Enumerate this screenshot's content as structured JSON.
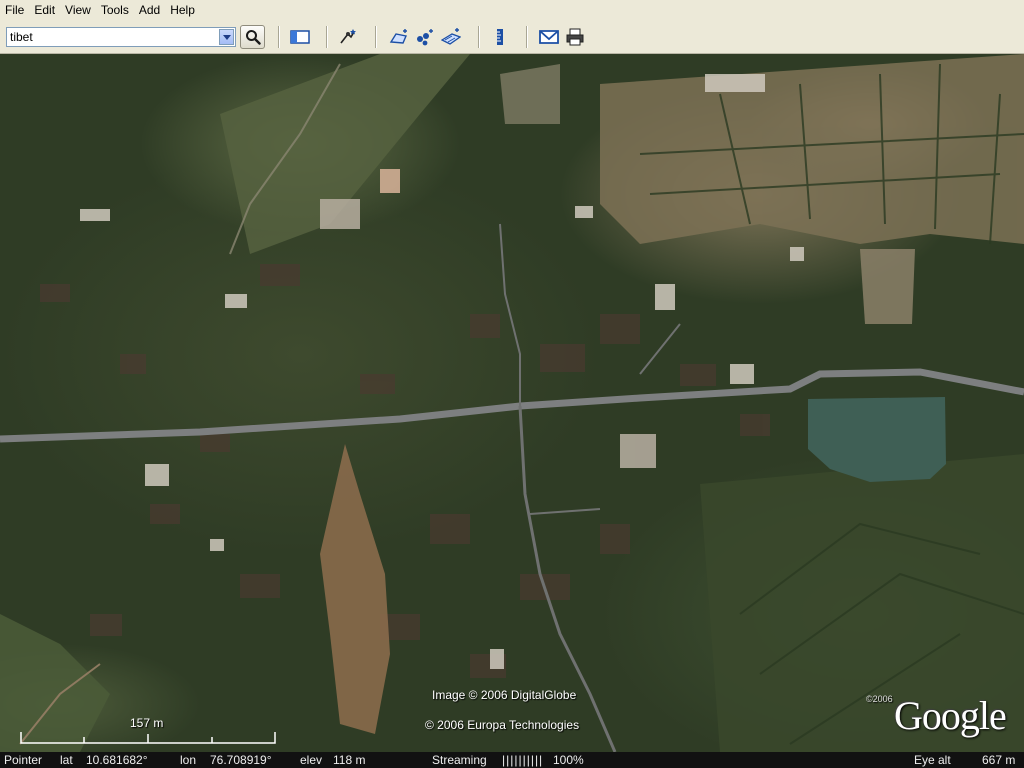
{
  "menu": {
    "items": [
      "File",
      "Edit",
      "View",
      "Tools",
      "Add",
      "Help"
    ]
  },
  "toolbar": {
    "search_value": "tibet",
    "icons": [
      "search-icon",
      "sidebar-toggle-icon",
      "tour-icon",
      "add-polygon-icon",
      "add-placemark-icon",
      "add-image-overlay-icon",
      "ruler-icon",
      "email-icon",
      "print-icon"
    ]
  },
  "map": {
    "attribution_image": "Image © 2006 DigitalGlobe",
    "attribution_terrain": "© 2006 Europa Technologies",
    "logo_text": "Google",
    "logo_year": "©2006",
    "scale_label": "157 m"
  },
  "status": {
    "pointer_label": "Pointer",
    "lat_label": "lat",
    "lat_value": "10.681682°",
    "lon_label": "lon",
    "lon_value": "76.708919°",
    "elev_label": "elev",
    "elev_value": "118 m",
    "streaming_label": "Streaming",
    "streaming_bars": "||||||||||",
    "streaming_percent": "100%",
    "eye_alt_label": "Eye alt",
    "eye_alt_value": "667 m"
  },
  "colors": {
    "chrome": "#ece9d8",
    "vegetation": "#2f3c25",
    "road": "#7d7f80",
    "water": "#3f5f55"
  }
}
